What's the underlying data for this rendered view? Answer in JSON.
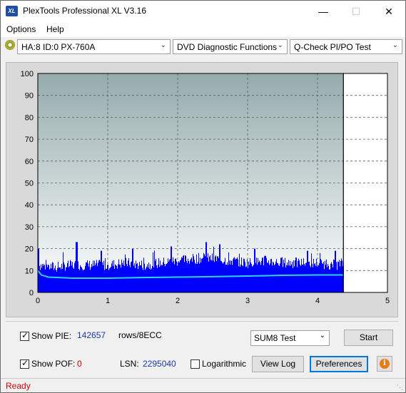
{
  "window": {
    "title": "PlexTools Professional XL V3.16",
    "app_icon_text": "XL",
    "minimize_icon": "minimize-icon",
    "maximize_icon": "maximize-icon",
    "close_icon": "close-icon"
  },
  "menu": {
    "options_label": "Options",
    "help_label": "Help"
  },
  "toolbar": {
    "drive_select": "HA:8 ID:0  PX-760A",
    "function_select": "DVD Diagnostic Functions",
    "test_select": "Q-Check PI/PO Test",
    "disc_icon": "disc-icon"
  },
  "chart_data": {
    "type": "area",
    "x_ticks": [
      "0",
      "1",
      "2",
      "3",
      "4",
      "5"
    ],
    "y_ticks": [
      "0",
      "10",
      "20",
      "30",
      "40",
      "50",
      "60",
      "70",
      "80",
      "90",
      "100"
    ],
    "xlim": [
      0,
      5
    ],
    "ylim": [
      0,
      100
    ],
    "x_data_end": 4.37,
    "grid": true,
    "colors": {
      "plot_bg_top": "#95abac",
      "plot_bg_bottom": "#ffffff",
      "pie_bars": "#0000ff",
      "average_line": "#2fd3e0",
      "panel_bg": "#d9d9d9",
      "unused_region": "#ffffff"
    },
    "series": [
      {
        "type": "bar",
        "x": [
          0,
          0.25,
          0.5,
          0.75,
          1.0,
          1.25,
          1.5,
          1.75,
          2.0,
          2.25,
          2.5,
          2.75,
          3.0,
          3.25,
          3.5,
          3.75,
          4.0,
          4.25,
          4.37
        ],
        "y": [
          13,
          12,
          13,
          13,
          13,
          14,
          13,
          14,
          15,
          16,
          16,
          15,
          14,
          15,
          14,
          14,
          14,
          13,
          14
        ],
        "peak_x": [
          0.0,
          0.55,
          0.9,
          1.35,
          1.9,
          2.4,
          2.6,
          3.1,
          3.85,
          4.25
        ],
        "peak_y": [
          20,
          23,
          19,
          20,
          21,
          23,
          22,
          20,
          19,
          19
        ]
      },
      {
        "type": "line",
        "x": [
          0,
          0.05,
          0.15,
          0.5,
          1.0,
          1.5,
          2.0,
          2.5,
          3.0,
          3.5,
          4.0,
          4.37
        ],
        "y": [
          10,
          8,
          7,
          6.5,
          6.5,
          6.8,
          7,
          7.2,
          7.5,
          7.8,
          8,
          8
        ]
      }
    ]
  },
  "controls": {
    "show_pie_label": "Show PIE:",
    "show_pie_checked": true,
    "pie_value": "142657",
    "pie_unit": "rows/8ECC",
    "show_pof_label": "Show POF:",
    "show_pof_checked": true,
    "pof_value": "0",
    "lsn_label": "LSN:",
    "lsn_value": "2295040",
    "logarithmic_label": "Logarithmic",
    "logarithmic_checked": false,
    "test_mode_select": "SUM8 Test",
    "start_label": "Start",
    "view_log_label": "View Log",
    "preferences_label": "Preferences",
    "info_icon": "info-icon"
  },
  "status": {
    "text": "Ready"
  }
}
